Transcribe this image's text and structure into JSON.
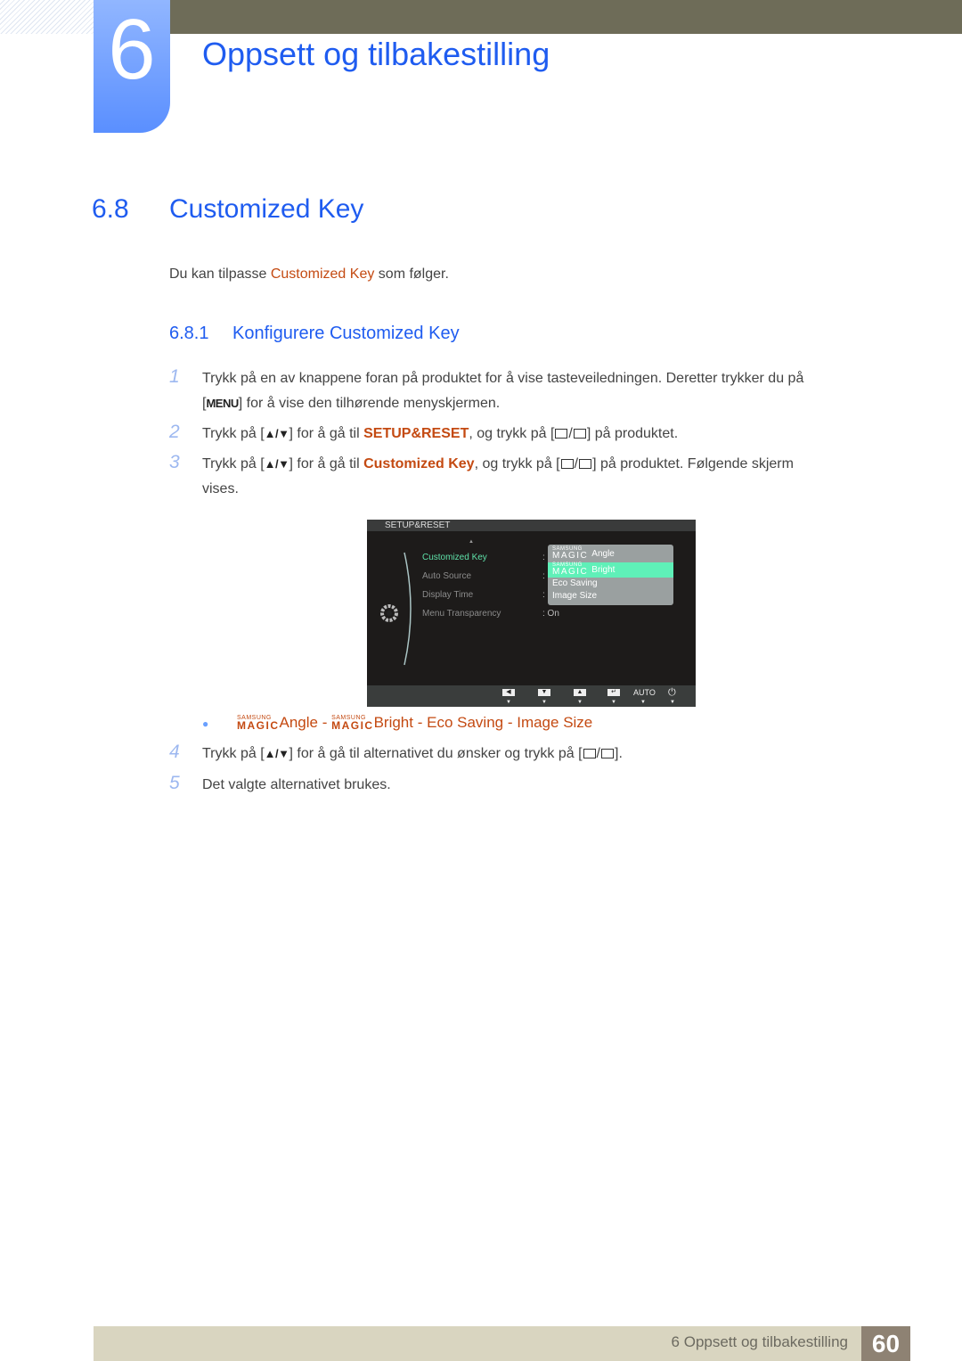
{
  "chapter": {
    "number": "6",
    "title": "Oppsett og tilbakestilling"
  },
  "section": {
    "number": "6.8",
    "title": "Customized Key"
  },
  "intro": {
    "before": "Du kan tilpasse ",
    "highlight": "Customized Key",
    "after": " som følger."
  },
  "subsection": {
    "number": "6.8.1",
    "title": "Konfigurere Customized Key"
  },
  "steps": [
    {
      "num": "1",
      "line1": "Trykk på en av knappene foran på produktet for å vise tasteveiledningen. Deretter trykker du på",
      "key": "MENU",
      "line2": " for å vise den tilhørende menyskjermen."
    },
    {
      "num": "2",
      "a": "Trykk på [",
      "arrows": "▲/▼",
      "b": "] for å gå til ",
      "hl": "SETUP&RESET",
      "c": ", og trykk på [",
      "d": "] på produktet."
    },
    {
      "num": "3",
      "a": "Trykk på [",
      "arrows": "▲/▼",
      "b": "] for å gå til ",
      "hl": "Customized Key",
      "c": ", og trykk på [",
      "d": "] på produktet. Følgende skjerm",
      "line2": "vises."
    },
    {
      "num": "4",
      "a": "Trykk på [",
      "arrows": "▲/▼",
      "b": "] for å gå til alternativet du ønsker og trykk på [",
      "d": "]."
    },
    {
      "num": "5",
      "text": "Det valgte alternativet brukes."
    }
  ],
  "osd": {
    "header": "SETUP&RESET",
    "up_arrow": "▲",
    "items": [
      {
        "label": "Customized Key",
        "value": ":"
      },
      {
        "label": "Auto Source",
        "value": ":"
      },
      {
        "label": "Display Time",
        "value": ":"
      },
      {
        "label": "Menu Transparency",
        "value": ": On"
      }
    ],
    "options": [
      {
        "brand_top": "SAMSUNG",
        "brand_bottom": "MAGIC",
        "label": "Angle",
        "selected": false
      },
      {
        "brand_top": "SAMSUNG",
        "brand_bottom": "MAGIC",
        "label": "Bright",
        "selected": true
      },
      {
        "label": "Eco Saving",
        "selected": false
      },
      {
        "label": "Image Size",
        "selected": false
      }
    ],
    "footer_buttons": [
      "left-arrow",
      "down-arrow",
      "up-arrow",
      "enter",
      "AUTO",
      "power"
    ],
    "auto_label": "AUTO"
  },
  "bullet": {
    "items": [
      {
        "brand_top": "SAMSUNG",
        "brand_bottom": "MAGIC",
        "label": "Angle"
      },
      {
        "brand_top": "SAMSUNG",
        "brand_bottom": "MAGIC",
        "label": "Bright"
      },
      {
        "label": "Eco Saving"
      },
      {
        "label": "Image Size"
      }
    ],
    "separator": " - "
  },
  "footer": {
    "text": "6 Oppsett og tilbakestilling",
    "page": "60"
  },
  "colors": {
    "heading_blue": "#1f5cf0",
    "highlight_orange": "#c44a12",
    "topbar": "#6e6c58",
    "footer_bg": "#d9d5c0",
    "page_box": "#8e8273",
    "osd_selected": "#5ff0b8"
  }
}
